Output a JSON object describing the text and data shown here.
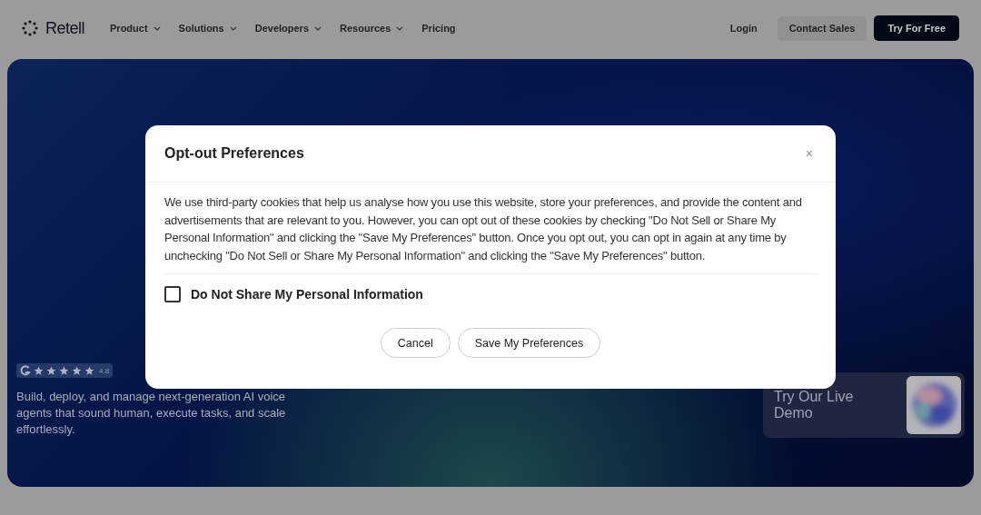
{
  "nav": {
    "logo": "Retell",
    "links": [
      {
        "label": "Product",
        "dropdown": true
      },
      {
        "label": "Solutions",
        "dropdown": true
      },
      {
        "label": "Developers",
        "dropdown": true
      },
      {
        "label": "Resources",
        "dropdown": true
      },
      {
        "label": "Pricing",
        "dropdown": false
      }
    ],
    "login": "Login",
    "contact": "Contact Sales",
    "cta": "Try For Free"
  },
  "hero": {
    "rating": {
      "stars": 5,
      "score": "4.8"
    },
    "description": "Build, deploy, and manage next-generation AI voice agents that sound human, execute tasks, and scale effortlessly.",
    "demo": {
      "label": "Try Our Live Demo",
      "kind": "picture"
    }
  },
  "dialog": {
    "title": "Opt-out Preferences",
    "close": "×",
    "body": "We use third-party cookies that help us analyse how you use this website, store your preferences, and provide the content and advertisements that are relevant to you. However, you can opt out of these cookies by checking \"Do Not Sell or Share My Personal Information\" and clicking the \"Save My Preferences\" button. Once you opt out, you can opt in again at any time by unchecking \"Do Not Sell or Share My Personal Information\" and clicking the \"Save My Preferences\" button.",
    "option": {
      "label": "Do Not Share My Personal Information",
      "checked": false
    },
    "buttons": [
      "Cancel",
      "Save My Preferences"
    ]
  }
}
